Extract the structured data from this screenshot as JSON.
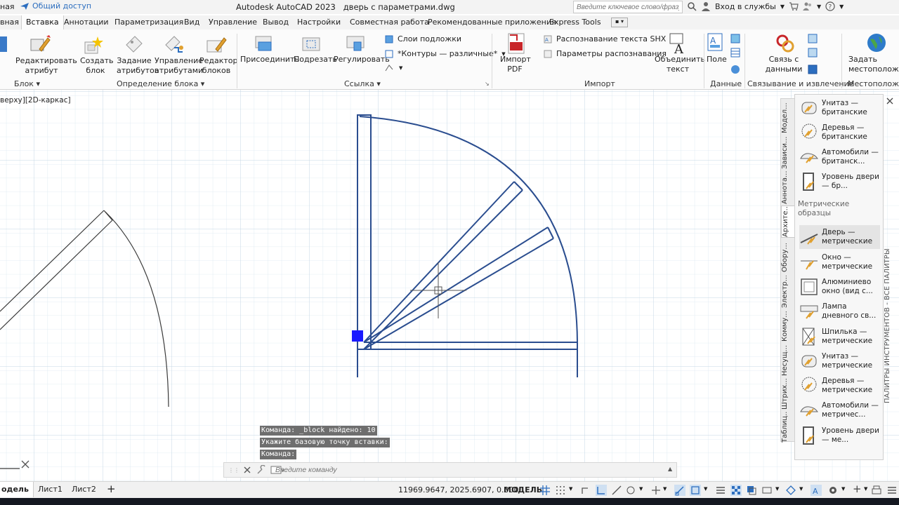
{
  "titlebar": {
    "workspace_prefix": "ная",
    "quick_access": "Общий доступ",
    "app_title": "Autodesk AutoCAD 2023",
    "file_title": "дверь с параметрами.dwg",
    "search_placeholder": "Введите ключевое слово/фразу",
    "signin": "Вход в службы"
  },
  "tabs": {
    "home_partial": "вная",
    "insert": "Вставка",
    "annotate": "Аннотации",
    "parametric": "Параметризация",
    "view": "Вид",
    "manage": "Управление",
    "output": "Вывод",
    "addins": "Настройки",
    "collaborate": "Совместная работа",
    "featured": "Рекомендованные приложения",
    "express": "Express Tools"
  },
  "ribbon": {
    "edit_attribute": "Редактировать атрибут",
    "create_block": "Создать блок",
    "define_attributes": "Задание атрибутов",
    "manage_attributes": "Управление атрибутами",
    "block_editor": "Редактор блоков",
    "attach": "Присоединить",
    "clip": "Подрезать",
    "adjust": "Регулировать",
    "underlay_layers": "Слои подложки",
    "frames_varies": "*Контуры — различные*",
    "import_pdf": "Импорт PDF",
    "recognize_shx": "Распознавание текста SHX",
    "recognition_settings": "Параметры распознавания",
    "combine_text": "Объединить текст",
    "field": "Поле",
    "data_link": "Связь с данными",
    "set_location": "Задать местоположение",
    "panel_block": "Блок",
    "panel_block_def": "Определение блока",
    "panel_reference": "Ссылка",
    "panel_import": "Импорт",
    "panel_data": "Данные",
    "panel_linking": "Связывание и извлечение",
    "panel_location": "Местоположение"
  },
  "viewport": {
    "label": "верху][2D-каркас]"
  },
  "palette": {
    "tabs": [
      "Модел...",
      "Зависи...",
      "Аннота...",
      "Архите...",
      "Обору...",
      "Электр...",
      "Комму...",
      "Несущ...",
      "Штрих...",
      "Таблиц..."
    ],
    "items_top": [
      {
        "name": "Унитаз — британские",
        "icon": "toilet-icon"
      },
      {
        "name": "Деревья — британские",
        "icon": "tree-icon"
      },
      {
        "name": "Автомобили — британск...",
        "icon": "car-icon"
      },
      {
        "name": "Уровень двери — бр...",
        "icon": "door-level-icon"
      }
    ],
    "section": "Метрические образцы",
    "items_bottom": [
      {
        "name": "Дверь — метрические",
        "icon": "door-icon"
      },
      {
        "name": "Окно — метрические",
        "icon": "window-icon"
      },
      {
        "name": "Алюминиево окно (вид с...",
        "icon": "aluminum-window-icon"
      },
      {
        "name": "Лампа дневного св...",
        "icon": "lamp-icon"
      },
      {
        "name": "Шпилька — метрические",
        "icon": "stud-icon"
      },
      {
        "name": "Унитаз — метрические",
        "icon": "toilet-icon"
      },
      {
        "name": "Деревья — метрические",
        "icon": "tree-icon"
      },
      {
        "name": "Автомобили — метричес...",
        "icon": "car-icon"
      },
      {
        "name": "Уровень двери — ме...",
        "icon": "door-level-icon"
      }
    ],
    "side_title": "ПАЛИТРЫ ИНСТРУМЕНТОВ - ВСЕ ПАЛИТРЫ"
  },
  "command": {
    "history": [
      "Команда: _block найдено: 10",
      "Укажите базовую точку вставки:",
      "Команда:"
    ],
    "placeholder": "Введите команду"
  },
  "status": {
    "layout_tabs": [
      "одель",
      "Лист1",
      "Лист2"
    ],
    "coords": "11969.9647, 2025.6907, 0.0000",
    "model": "МОДЕЛЬ"
  },
  "colors": {
    "accent": "#2c6ebf",
    "drawing": "#2a4d8f",
    "grip": "#1a1aff",
    "grid": "#d9e7f0"
  }
}
